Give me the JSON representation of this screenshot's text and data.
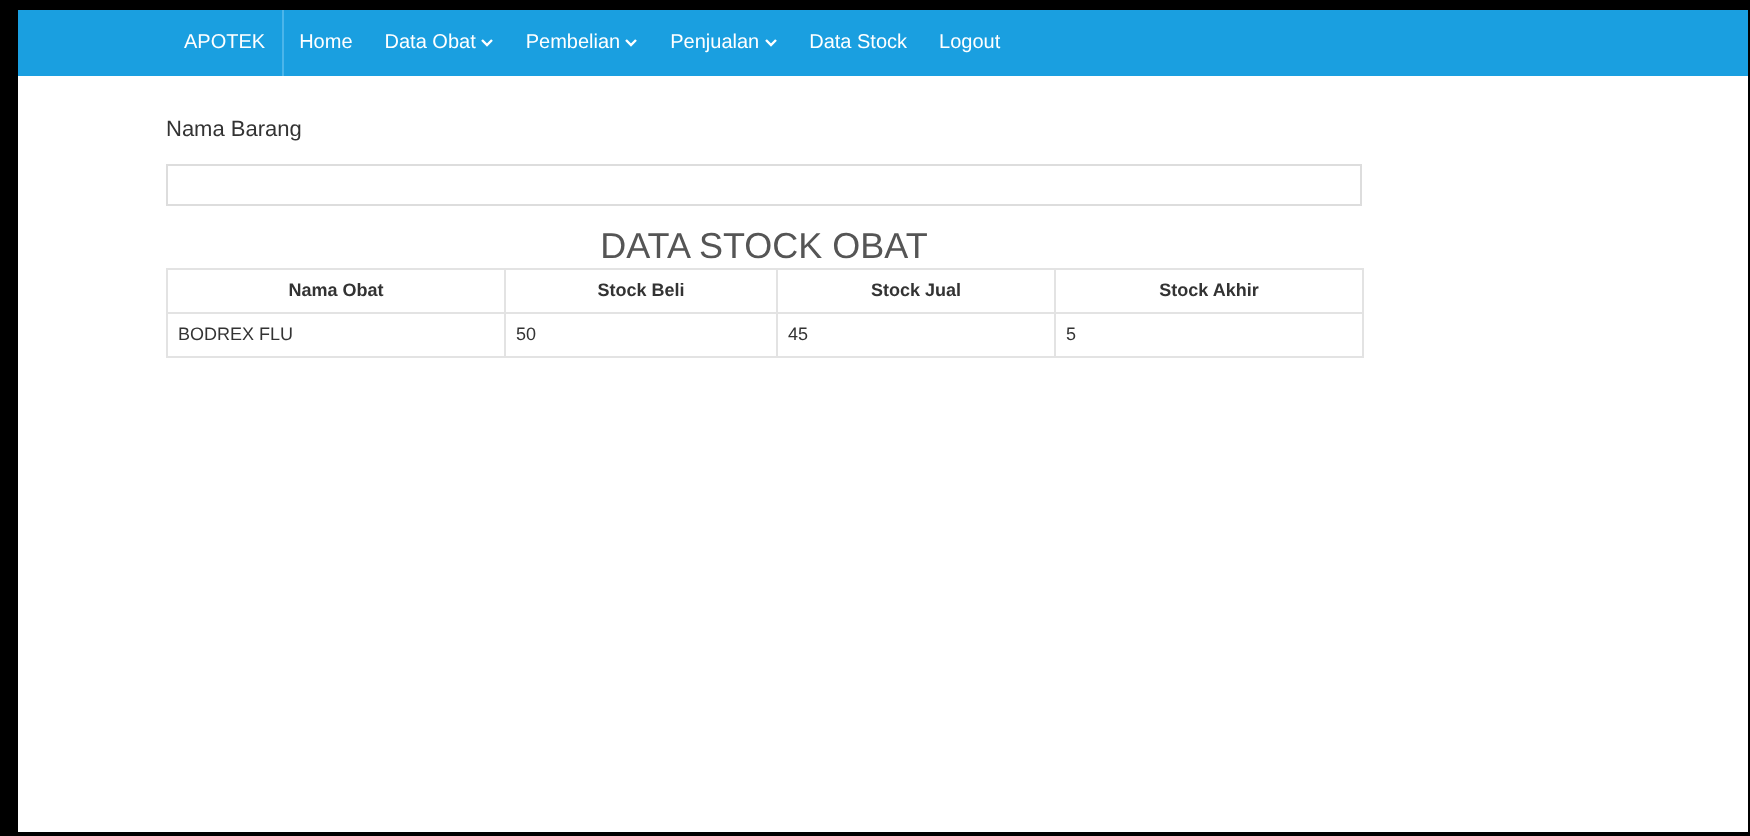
{
  "navbar": {
    "brand": "APOTEK",
    "items": [
      {
        "label": "Home",
        "kind": "link"
      },
      {
        "label": "Data Obat",
        "kind": "dropdown"
      },
      {
        "label": "Pembelian",
        "kind": "dropdown"
      },
      {
        "label": "Penjualan",
        "kind": "dropdown"
      },
      {
        "label": "Data Stock",
        "kind": "link"
      },
      {
        "label": "Logout",
        "kind": "link"
      }
    ]
  },
  "search": {
    "label": "Nama Barang"
  },
  "table": {
    "title": "DATA STOCK OBAT",
    "columns": [
      "Nama Obat",
      "Stock Beli",
      "Stock Jual",
      "Stock Akhir"
    ],
    "rows": [
      [
        "BODREX FLU",
        "50",
        "45",
        "5"
      ]
    ]
  }
}
